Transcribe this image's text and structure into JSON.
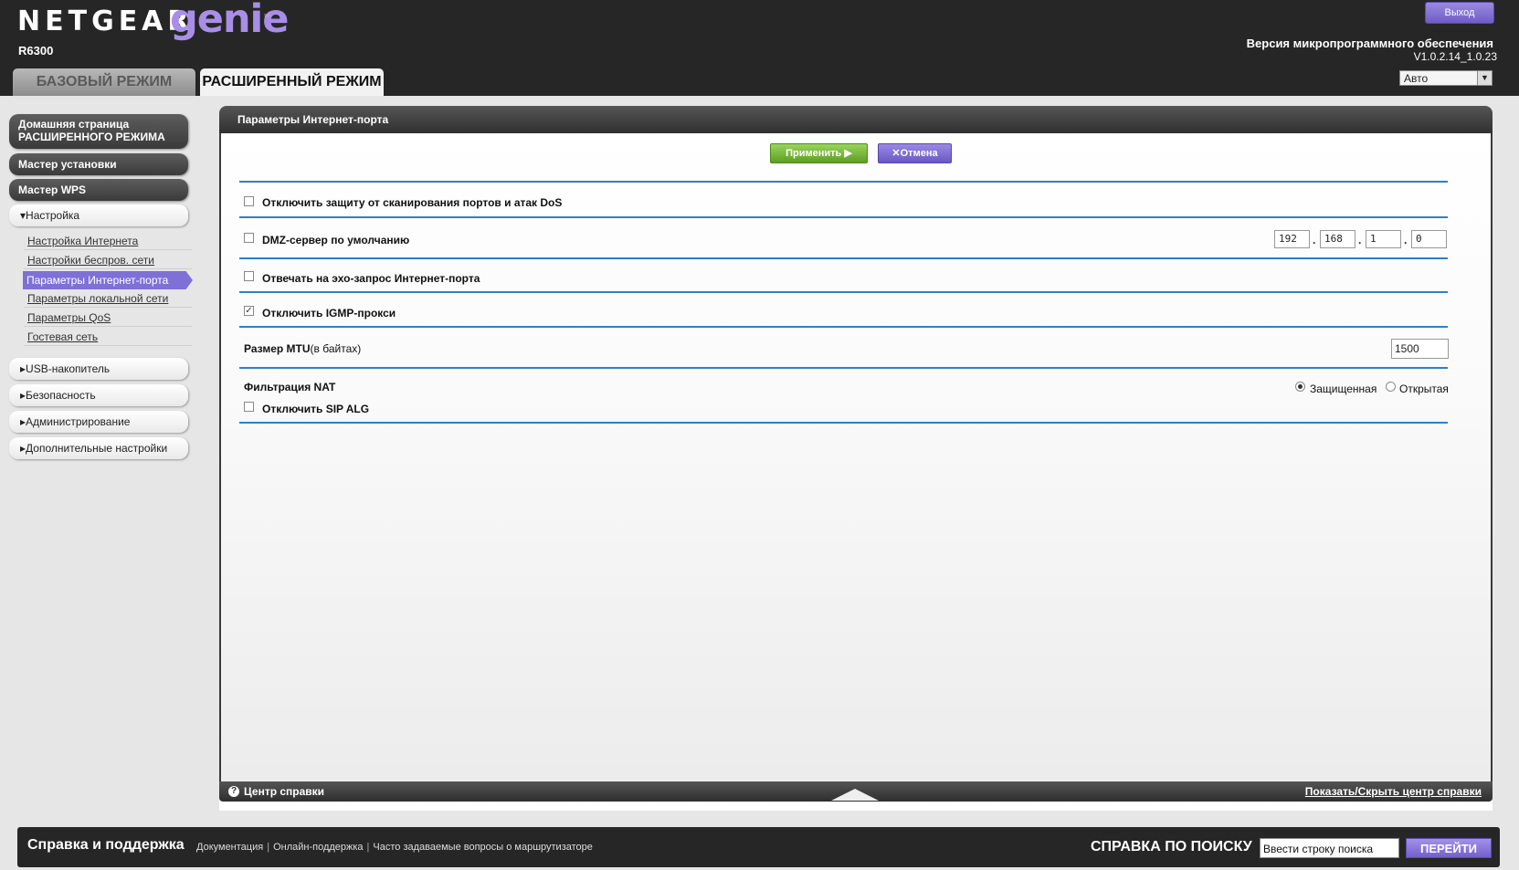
{
  "header": {
    "brand": "NETGEAR",
    "product": "genie",
    "trademark": "™",
    "model": "R6300",
    "logout_label": "Выход",
    "firmware_label": "Версия микропрограммного обеспечения",
    "firmware_version": "V1.0.2.14_1.0.23",
    "language_value": "Авто",
    "tabs": {
      "basic": "БАЗОВЫЙ РЕЖИМ",
      "advanced": "РАСШИРЕННЫЙ РЕЖИМ"
    }
  },
  "sidebar": {
    "home_line1": "Домашняя страница",
    "home_line2": "РАСШИРЕННОГО РЕЖИМА",
    "setup_wizard": "Мастер установки",
    "wps_wizard": "Мастер WPS",
    "setup_section": "Настройка",
    "setup_items": [
      "Настройка Интернета",
      "Настройки беспров. сети",
      "Параметры Интернет-порта",
      "Параметры локальной сети",
      "Параметры QoS",
      "Гостевая сеть"
    ],
    "sections": [
      "USB-накопитель",
      "Безопасность",
      "Администрирование",
      "Дополнительные настройки"
    ]
  },
  "panel": {
    "title": "Параметры Интернет-порта",
    "apply_label": "Применить",
    "cancel_label": "Отмена",
    "disable_dos": {
      "label": "Отключить защиту от сканирования портов и атак DoS",
      "checked": false
    },
    "dmz": {
      "label": "DMZ-сервер по умолчанию",
      "checked": false,
      "ip": [
        "192",
        "168",
        "1",
        "0"
      ]
    },
    "echo": {
      "label": "Отвечать на эхо-запрос Интернет-порта",
      "checked": false
    },
    "igmp": {
      "label": "Отключить IGMP-прокси",
      "checked": true
    },
    "mtu": {
      "label": "Размер MTU",
      "unit": "(в байтах)",
      "value": "1500"
    },
    "nat": {
      "label": "Фильтрация NAT",
      "options": [
        "Защищенная",
        "Открытая"
      ],
      "selected": "Защищенная"
    },
    "sip_alg": {
      "label": "Отключить SIP ALG",
      "checked": false
    },
    "help_center": "Центр справки",
    "help_toggle": "Показать/Скрыть центр справки"
  },
  "footer": {
    "title": "Справка и поддержка",
    "links": [
      "Документация",
      "Онлайн-поддержка",
      "Часто задаваемые вопросы о маршрутизаторе"
    ],
    "search_label": "СПРАВКА ПО ПОИСКУ",
    "search_placeholder": "Ввести строку поиска",
    "go_label": "ПЕРЕЙТИ"
  },
  "colors": {
    "accent": "#7f70d8",
    "apply": "#6aae2b",
    "divider": "#2f7fc5",
    "header_bg": "#262626"
  }
}
